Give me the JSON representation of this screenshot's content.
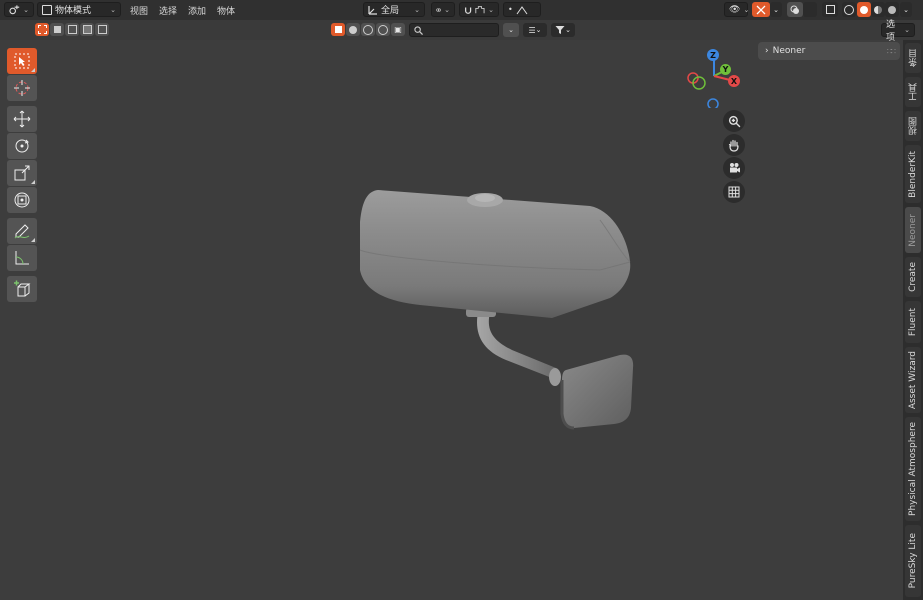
{
  "header": {
    "mode_label": "物体模式",
    "menu": [
      "视图",
      "选择",
      "添加",
      "物体"
    ],
    "orientation_label": "全局",
    "options_label": "选项"
  },
  "search": {
    "placeholder": ""
  },
  "panel": {
    "title": "Neoner"
  },
  "sidebar_tabs": [
    "条目",
    "工具",
    "视图",
    "BlenderKit",
    "Neoner",
    "Create",
    "Fluent",
    "Asset Wizard",
    "Physical Atmosphere",
    "PureSky Lite"
  ],
  "active_tab": "Neoner",
  "gizmo": {
    "z": "Z",
    "y": "Y",
    "x": "X"
  },
  "colors": {
    "accent": "#e05a2b",
    "x_axis": "#e34948",
    "y_axis": "#6fbf3a",
    "z_axis": "#3c87e0"
  }
}
